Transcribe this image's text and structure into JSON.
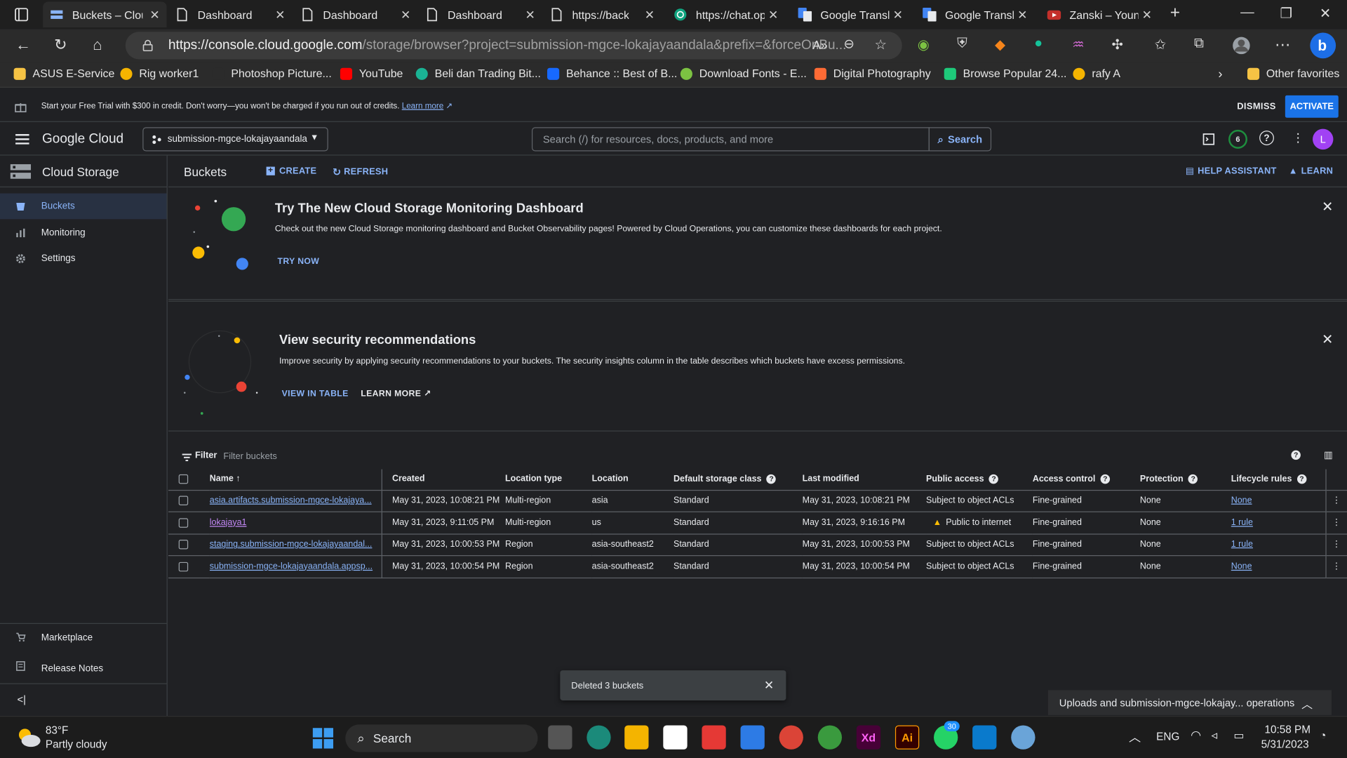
{
  "browser": {
    "tabs": [
      {
        "label": "Buckets – Cloud Storage",
        "active": true
      },
      {
        "label": "Dashboard"
      },
      {
        "label": "Dashboard"
      },
      {
        "label": "Dashboard"
      },
      {
        "label": "https://backend"
      },
      {
        "label": "https://chat.openai"
      },
      {
        "label": "Google Translate"
      },
      {
        "label": "Google Translate"
      },
      {
        "label": "Zanski – Young"
      }
    ],
    "url_host": "https://console.cloud.google.com",
    "url_path": "/storage/browser?project=submission-mgce-lokajayaandala&prefix=&forceOnBu...",
    "bookmarks": [
      {
        "label": "ASUS E-Service",
        "color": "#f6c344"
      },
      {
        "label": "Rig worker1",
        "color": "#f5b400"
      },
      {
        "label": "Photoshop Picture...",
        "color": "#2b2b2b"
      },
      {
        "label": "YouTube",
        "color": "#ff0000"
      },
      {
        "label": "Beli dan Trading Bit...",
        "color": "#1ab394"
      },
      {
        "label": "Behance :: Best of B...",
        "color": "#1769ff"
      },
      {
        "label": "Download Fonts - E...",
        "color": "#7cc242"
      },
      {
        "label": "Digital Photography",
        "color": "#ff6b35"
      },
      {
        "label": "Browse Popular 24...",
        "color": "#1ec97a"
      },
      {
        "label": "rafy A",
        "color": "#f5b400"
      }
    ],
    "other_favorites": "Other favorites"
  },
  "trial": {
    "message": "Start your Free Trial with $300 in credit. Don't worry—you won't be charged if you run out of credits.",
    "learn_more": "Learn more",
    "dismiss": "DISMISS",
    "activate": "ACTIVATE"
  },
  "header": {
    "logo_google": "Google",
    "logo_cloud": "Cloud",
    "project": "submission-mgce-lokajayaandala",
    "search_placeholder": "Search (/) for resources, docs, products, and more",
    "search_button": "Search",
    "notifications": "6",
    "avatar": "L"
  },
  "sidebar": {
    "title": "Cloud Storage",
    "items": [
      "Buckets",
      "Monitoring",
      "Settings"
    ],
    "bottom": [
      "Marketplace",
      "Release Notes"
    ]
  },
  "page": {
    "title": "Buckets",
    "create": "CREATE",
    "refresh": "REFRESH",
    "help_assistant": "HELP ASSISTANT",
    "learn": "LEARN"
  },
  "banner1": {
    "title": "Try The New Cloud Storage Monitoring Dashboard",
    "text": "Check out the new Cloud Storage monitoring dashboard and Bucket Observability pages! Powered by Cloud Operations, you can customize these dashboards for each project.",
    "button": "TRY NOW"
  },
  "banner2": {
    "title": "View security recommendations",
    "text": "Improve security by applying security recommendations to your buckets. The security insights column in the table describes which buckets have excess permissions.",
    "button1": "VIEW IN TABLE",
    "button2": "LEARN MORE"
  },
  "filter": {
    "label": "Filter",
    "placeholder": "Filter buckets"
  },
  "table": {
    "headers": [
      "Name",
      "Created",
      "Location type",
      "Location",
      "Default storage class",
      "Last modified",
      "Public access",
      "Access control",
      "Protection",
      "Lifecycle rules"
    ],
    "rows": [
      {
        "name": "asia.artifacts.submission-mgce-lokajaya...",
        "created": "May 31, 2023, 10:08:21 PM",
        "loctype": "Multi-region",
        "location": "asia",
        "storage": "Standard",
        "modified": "May 31, 2023, 10:08:21 PM",
        "public": "Subject to object ACLs",
        "access": "Fine-grained",
        "protection": "None",
        "lifecycle": "None"
      },
      {
        "name": "lokajaya1",
        "created": "May 31, 2023, 9:11:05 PM",
        "loctype": "Multi-region",
        "location": "us",
        "storage": "Standard",
        "modified": "May 31, 2023, 9:16:16 PM",
        "public": "Public to internet",
        "access": "Fine-grained",
        "protection": "None",
        "lifecycle": "1 rule"
      },
      {
        "name": "staging.submission-mgce-lokajayaandal...",
        "created": "May 31, 2023, 10:00:53 PM",
        "loctype": "Region",
        "location": "asia-southeast2",
        "storage": "Standard",
        "modified": "May 31, 2023, 10:00:53 PM",
        "public": "Subject to object ACLs",
        "access": "Fine-grained",
        "protection": "None",
        "lifecycle": "1 rule"
      },
      {
        "name": "submission-mgce-lokajayaandala.appsp...",
        "created": "May 31, 2023, 10:00:54 PM",
        "loctype": "Region",
        "location": "asia-southeast2",
        "storage": "Standard",
        "modified": "May 31, 2023, 10:00:54 PM",
        "public": "Subject to object ACLs",
        "access": "Fine-grained",
        "protection": "None",
        "lifecycle": "None"
      }
    ]
  },
  "toast": "Deleted 3 buckets",
  "operations": "Uploads and submission-mgce-lokajay... operations",
  "taskbar": {
    "weather_temp": "83°F",
    "weather_desc": "Partly cloudy",
    "search": "Search",
    "lang": "ENG",
    "time": "10:58 PM",
    "date": "5/31/2023",
    "whatsapp_badge": "30"
  }
}
